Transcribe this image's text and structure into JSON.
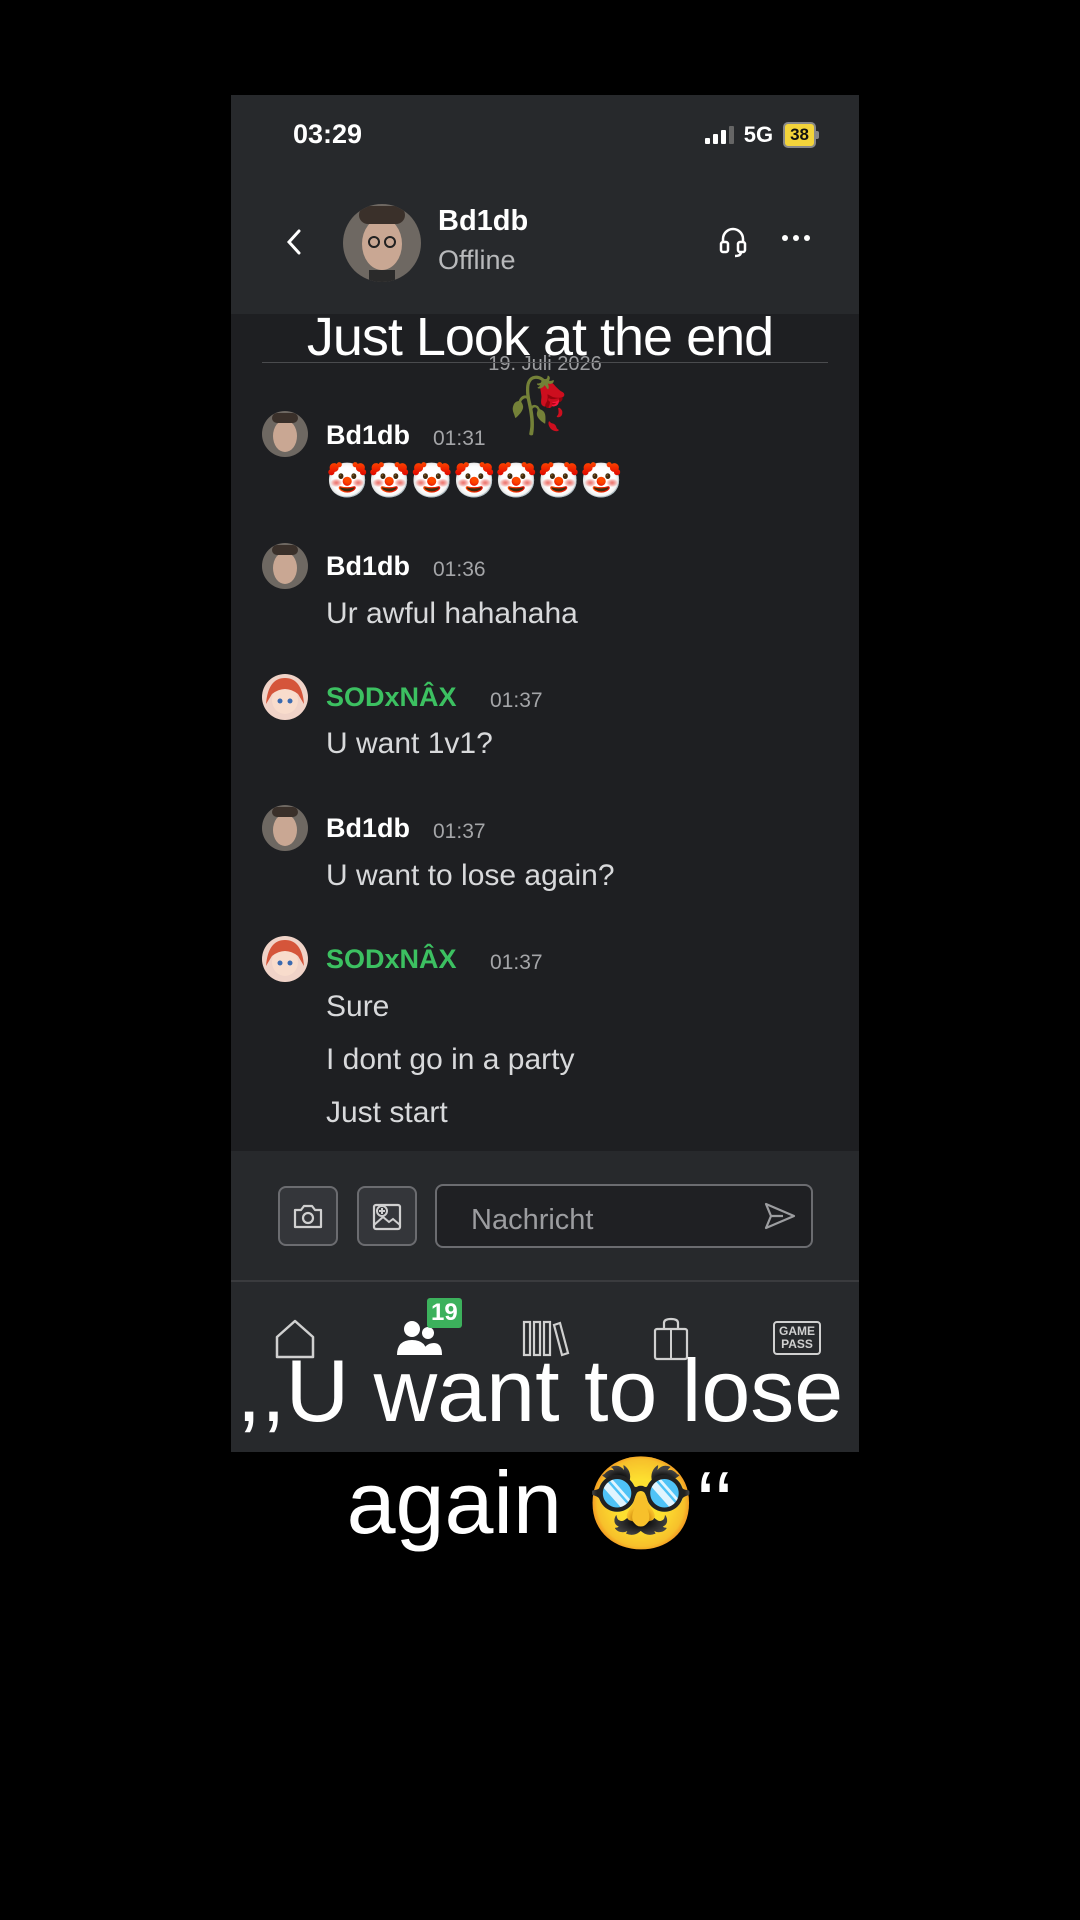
{
  "status_bar": {
    "time": "03:29",
    "network": "5G",
    "battery": "38"
  },
  "header": {
    "contact_name": "Bd1db",
    "contact_status": "Offline",
    "back_icon": "chevron-left-icon",
    "headset_icon": "headset-icon",
    "more_icon": "more-icon"
  },
  "chat": {
    "date": "19. Juli 2026",
    "messages": [
      {
        "author": "Bd1db",
        "time": "01:31",
        "lines": [
          "🤡🤡🤡🤡🤡🤡🤡"
        ]
      },
      {
        "author": "Bd1db",
        "time": "01:36",
        "lines": [
          "Ur awful hahahaha"
        ]
      },
      {
        "author": "SODxNÂX",
        "time": "01:37",
        "lines": [
          "U want 1v1?"
        ]
      },
      {
        "author": "Bd1db",
        "time": "01:37",
        "lines": [
          "U want to lose again?"
        ]
      },
      {
        "author": "SODxNÂX",
        "time": "01:37",
        "lines": [
          "Sure",
          "I dont go in a party",
          "Just start"
        ]
      }
    ]
  },
  "composer": {
    "placeholder": "Nachricht",
    "camera_icon": "camera-icon",
    "image_icon": "add-image-icon",
    "send_icon": "send-icon"
  },
  "nav": {
    "items": [
      "home-icon",
      "friends-icon",
      "library-icon",
      "store-icon",
      "game-pass-icon"
    ],
    "friends_badge": "19",
    "gamepass_label_1": "GAME",
    "gamepass_label_2": "PASS"
  },
  "overlay": {
    "top_caption": "Just Look at the end",
    "top_emoji": "🥀",
    "bottom_caption": ",,U want to lose again 🥸‘‘"
  },
  "colors": {
    "background": "#000000",
    "app_bg": "#1e1f22",
    "header_bg": "#27292c",
    "username_green": "#3cc061",
    "badge_green": "#3cb15c",
    "battery_yellow": "#f3d43a"
  }
}
